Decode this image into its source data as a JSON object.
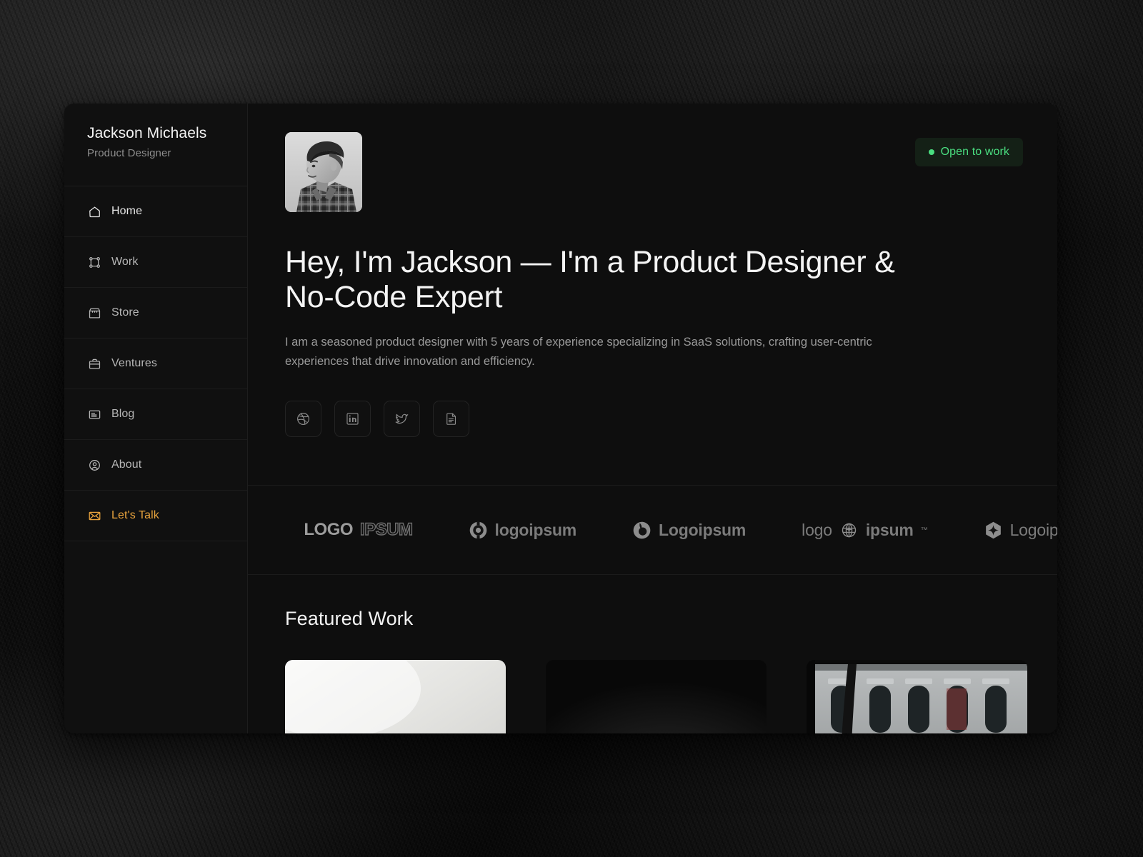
{
  "sidebar": {
    "name": "Jackson Michaels",
    "role": "Product Designer",
    "items": [
      {
        "label": "Home",
        "icon": "home-icon"
      },
      {
        "label": "Work",
        "icon": "nodes-icon"
      },
      {
        "label": "Store",
        "icon": "storefront-icon"
      },
      {
        "label": "Ventures",
        "icon": "briefcase-icon"
      },
      {
        "label": "Blog",
        "icon": "article-icon"
      },
      {
        "label": "About",
        "icon": "user-circle-icon"
      },
      {
        "label": "Let's Talk",
        "icon": "envelope-icon"
      }
    ]
  },
  "hero": {
    "badge": {
      "text": "Open to work",
      "dot_color": "#4ade80",
      "text_color": "#4ade80",
      "bg_color": "#142016"
    },
    "avatar_alt": "Portrait of Jackson Michaels",
    "headline": "Hey, I'm Jackson — I'm a Product Designer & No-Code Expert",
    "subtitle": "I am a seasoned product designer with 5 years of experience specializing in SaaS solutions, crafting user-centric experiences that drive innovation and efficiency.",
    "socials": [
      {
        "name": "dribbble-icon",
        "label": "Dribbble"
      },
      {
        "name": "linkedin-icon",
        "label": "LinkedIn"
      },
      {
        "name": "twitter-icon",
        "label": "Twitter"
      },
      {
        "name": "resume-icon",
        "label": "Resume"
      }
    ]
  },
  "logos": [
    {
      "text": "ipsum",
      "style": "partial",
      "icon": "none"
    },
    {
      "text": "LOGO",
      "text2": "IPSUM",
      "style": "split",
      "icon": "none"
    },
    {
      "text": "logoipsum",
      "style": "light",
      "icon": "target-icon"
    },
    {
      "text": "Logoipsum",
      "style": "bold",
      "icon": "droplet-icon"
    },
    {
      "text": "logo",
      "text2": "ipsum",
      "style": "globe",
      "icon": "globe-icon",
      "tm": "™"
    },
    {
      "text": "Logoipsum",
      "style": "light",
      "icon": "diamond-hex-icon"
    }
  ],
  "featured": {
    "title": "Featured Work",
    "cards": [
      {
        "name": "card-phone-mockup",
        "theme": "light"
      },
      {
        "name": "card-dark-product",
        "theme": "dark"
      },
      {
        "name": "card-architecture",
        "theme": "photo"
      }
    ]
  },
  "accent_colors": {
    "amber": "#e8a33d",
    "green": "#4ade80",
    "window_bg": "#0e0e0e",
    "sidebar_bg": "#101010",
    "divider": "#1d1d1d"
  }
}
